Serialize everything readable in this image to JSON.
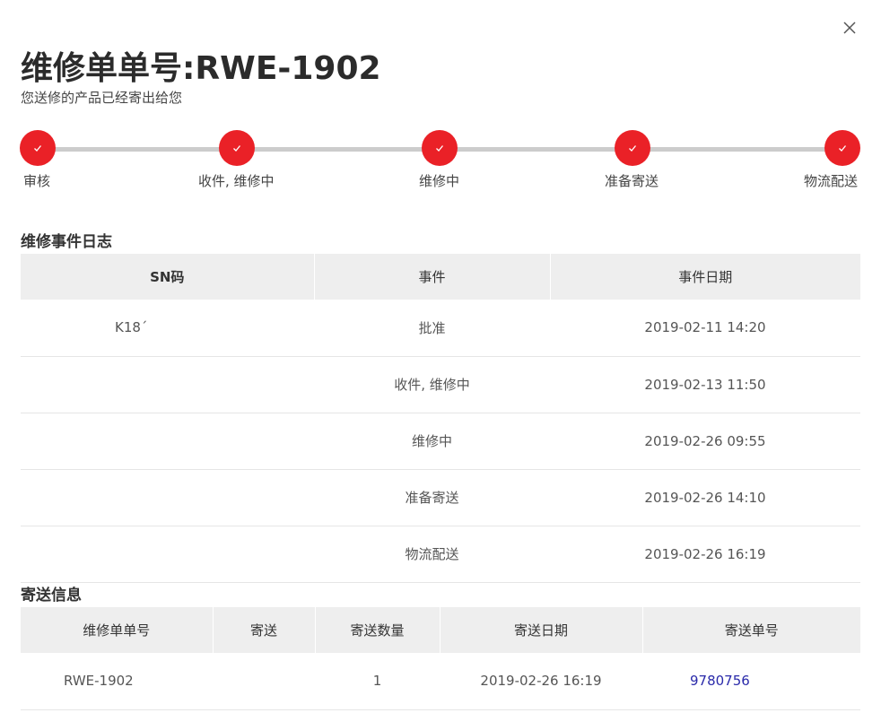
{
  "dialog": {
    "title": "维修单单号:RWE-1902",
    "subtitle": "您送修的产品已经寄出给您"
  },
  "colors": {
    "accent": "#ea2127",
    "track": "#cccccc",
    "header_bg": "#eeeeee",
    "link": "#2a2aaa"
  },
  "icons": {
    "close": "close-icon",
    "step_done": "check-icon"
  },
  "stepper": {
    "steps": [
      {
        "label": "审核",
        "status": "done"
      },
      {
        "label": "收件, 维修中",
        "status": "done"
      },
      {
        "label": "维修中",
        "status": "done"
      },
      {
        "label": "准备寄送",
        "status": "done"
      },
      {
        "label": "物流配送",
        "status": "done"
      }
    ]
  },
  "events": {
    "title": "维修事件日志",
    "headers": [
      "SN码",
      "事件",
      "事件日期"
    ],
    "rows": [
      {
        "sn": "K18´",
        "event": "批准",
        "date": "2019-02-11 14:20"
      },
      {
        "sn": "",
        "event": "收件, 维修中",
        "date": "2019-02-13 11:50"
      },
      {
        "sn": "",
        "event": "维修中",
        "date": "2019-02-26 09:55"
      },
      {
        "sn": "",
        "event": "准备寄送",
        "date": "2019-02-26 14:10"
      },
      {
        "sn": "",
        "event": "物流配送",
        "date": "2019-02-26 16:19"
      }
    ]
  },
  "shipping": {
    "title": "寄送信息",
    "headers": [
      "维修单单号",
      "寄送",
      "寄送数量",
      "寄送日期",
      "寄送单号"
    ],
    "rows": [
      {
        "order": "RWE-1902",
        "ship": "",
        "qty": "1",
        "date": "2019-02-26 16:19",
        "tracking": "9780756"
      }
    ]
  }
}
